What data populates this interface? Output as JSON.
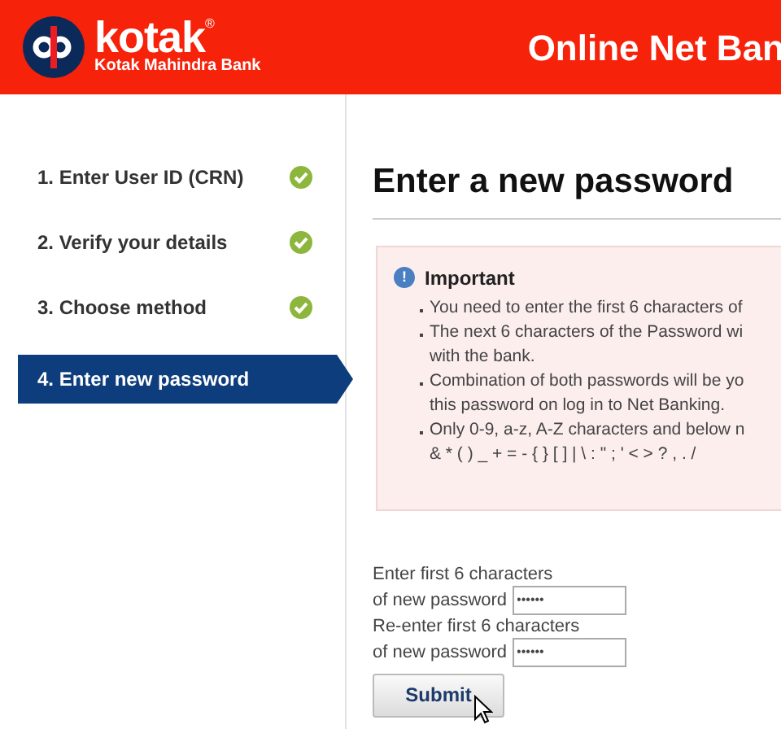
{
  "header": {
    "logo_wordmark": "kotak",
    "logo_registered": "®",
    "logo_subtitle": "Kotak Mahindra Bank",
    "title": "Online Net Ban"
  },
  "steps": [
    {
      "label": "1. Enter User ID (CRN)",
      "completed": true,
      "selected": false
    },
    {
      "label": "2. Verify your details",
      "completed": true,
      "selected": false
    },
    {
      "label": "3. Choose method",
      "completed": true,
      "selected": false
    },
    {
      "label": "4. Enter new password",
      "completed": false,
      "selected": true
    }
  ],
  "page_title": "Enter a new password",
  "notice": {
    "icon": "!",
    "title": "Important",
    "lines": [
      {
        "text": "You need to enter the first 6 characters of",
        "bullet": true
      },
      {
        "text": "The next 6 characters of the Password wi",
        "bullet": true
      },
      {
        "text": "with the bank.",
        "bullet": false
      },
      {
        "text": "Combination of both passwords will be yo",
        "bullet": true
      },
      {
        "text": "this password on log in to Net Banking.",
        "bullet": false
      },
      {
        "text": "Only 0-9, a-z, A-Z characters and below n",
        "bullet": true
      },
      {
        "text": "& * ( ) _ + = - { } [ ] | \\ : \" ; ' < > ? , . /",
        "bullet": false
      }
    ]
  },
  "form": {
    "fields": [
      {
        "label_line1": "Enter first 6 characters",
        "label_line2": "of new password",
        "value": "••••••"
      },
      {
        "label_line1": "Re-enter first 6 characters",
        "label_line2": "of new password",
        "value": "••••••"
      }
    ],
    "submit": "Submit"
  }
}
